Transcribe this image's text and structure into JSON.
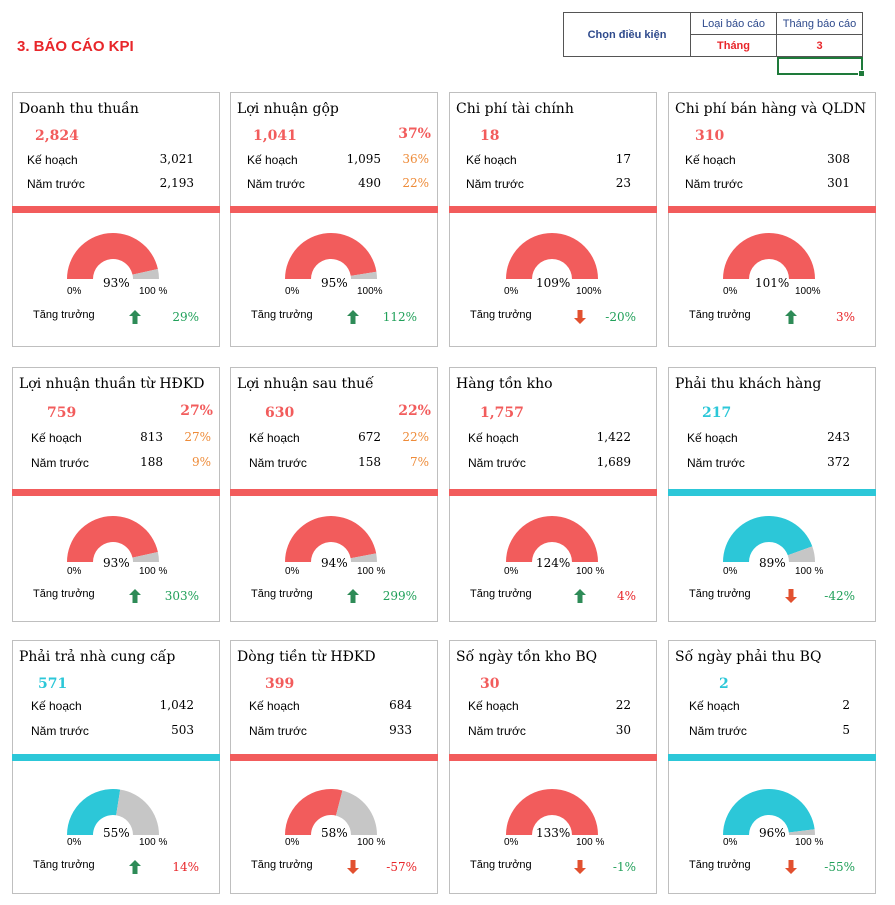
{
  "page_title": "3. BÁO CÁO KPI",
  "condition": {
    "label": "Chọn điều kiện",
    "report_type_header": "Loại báo cáo",
    "month_header": "Tháng báo cáo",
    "report_type_value": "Tháng",
    "month_value": "3"
  },
  "labels": {
    "plan": "Kế hoạch",
    "last_year": "Năm trước",
    "growth": "Tăng trưởng",
    "zero": "0%"
  },
  "colors": {
    "red": "#f25c5c",
    "teal": "#2cc7d8",
    "gray": "#c6c6c6",
    "up": "#2e8b57",
    "down": "#e2502f"
  },
  "cards": [
    {
      "title": "Doanh thu thuần",
      "actual": "2,824",
      "actual_pct": "",
      "plan": "3,021",
      "plan_pct": "",
      "last_year": "2,193",
      "last_year_pct": "",
      "gauge_pct": "93%",
      "gauge_value": 0.93,
      "max_label": "100 %",
      "growth": "29%",
      "growth_dir": "up",
      "theme": "red"
    },
    {
      "title": "Lợi nhuận gộp",
      "actual": "1,041",
      "actual_pct": "37%",
      "plan": "1,095",
      "plan_pct": "36%",
      "last_year": "490",
      "last_year_pct": "22%",
      "gauge_pct": "95%",
      "gauge_value": 0.95,
      "max_label": "100%",
      "growth": "112%",
      "growth_dir": "up",
      "theme": "red"
    },
    {
      "title": "Chi phí tài chính",
      "actual": "18",
      "actual_pct": "",
      "plan": "17",
      "plan_pct": "",
      "last_year": "23",
      "last_year_pct": "",
      "gauge_pct": "109%",
      "gauge_value": 1.09,
      "max_label": "100%",
      "growth": "-20%",
      "growth_dir": "down",
      "theme": "red"
    },
    {
      "title": "Chi phí bán hàng và QLDN",
      "actual": "310",
      "actual_pct": "",
      "plan": "308",
      "plan_pct": "",
      "last_year": "301",
      "last_year_pct": "",
      "gauge_pct": "101%",
      "gauge_value": 1.01,
      "max_label": "100%",
      "growth": "3%",
      "growth_dir": "up",
      "theme": "red"
    },
    {
      "title": "Lợi nhuận thuần từ HĐKD",
      "actual": "759",
      "actual_pct": "27%",
      "plan": "813",
      "plan_pct": "27%",
      "last_year": "188",
      "last_year_pct": "9%",
      "gauge_pct": "93%",
      "gauge_value": 0.93,
      "max_label": "100 %",
      "growth": "303%",
      "growth_dir": "up",
      "theme": "red"
    },
    {
      "title": "Lợi nhuận sau thuế",
      "actual": "630",
      "actual_pct": "22%",
      "plan": "672",
      "plan_pct": "22%",
      "last_year": "158",
      "last_year_pct": "7%",
      "gauge_pct": "94%",
      "gauge_value": 0.94,
      "max_label": "100 %",
      "growth": "299%",
      "growth_dir": "up",
      "theme": "red"
    },
    {
      "title": "Hàng tồn kho",
      "actual": "1,757",
      "actual_pct": "",
      "plan": "1,422",
      "plan_pct": "",
      "last_year": "1,689",
      "last_year_pct": "",
      "gauge_pct": "124%",
      "gauge_value": 1.24,
      "max_label": "100 %",
      "growth": "4%",
      "growth_dir": "up",
      "theme": "red"
    },
    {
      "title": "Phải thu khách hàng",
      "actual": "217",
      "actual_pct": "",
      "plan": "243",
      "plan_pct": "",
      "last_year": "372",
      "last_year_pct": "",
      "gauge_pct": "89%",
      "gauge_value": 0.89,
      "max_label": "100 %",
      "growth": "-42%",
      "growth_dir": "down",
      "theme": "teal"
    },
    {
      "title": "Phải trả nhà cung cấp",
      "actual": "571",
      "actual_pct": "",
      "plan": "1,042",
      "plan_pct": "",
      "last_year": "503",
      "last_year_pct": "",
      "gauge_pct": "55%",
      "gauge_value": 0.55,
      "max_label": "100 %",
      "growth": "14%",
      "growth_dir": "up",
      "theme": "teal"
    },
    {
      "title": "Dòng tiền từ HĐKD",
      "actual": "399",
      "actual_pct": "",
      "plan": "684",
      "plan_pct": "",
      "last_year": "933",
      "last_year_pct": "",
      "gauge_pct": "58%",
      "gauge_value": 0.58,
      "max_label": "100 %",
      "growth": "-57%",
      "growth_dir": "down",
      "theme": "red"
    },
    {
      "title": "Số ngày tồn kho BQ",
      "actual": "30",
      "actual_pct": "",
      "plan": "22",
      "plan_pct": "",
      "last_year": "30",
      "last_year_pct": "",
      "gauge_pct": "133%",
      "gauge_value": 1.33,
      "max_label": "100 %",
      "growth": "-1%",
      "growth_dir": "down",
      "theme": "red"
    },
    {
      "title": "Số ngày phải thu BQ",
      "actual": "2",
      "actual_pct": "",
      "plan": "2",
      "plan_pct": "",
      "last_year": "5",
      "last_year_pct": "",
      "gauge_pct": "96%",
      "gauge_value": 0.96,
      "max_label": "100 %",
      "growth": "-55%",
      "growth_dir": "down",
      "theme": "teal"
    }
  ]
}
